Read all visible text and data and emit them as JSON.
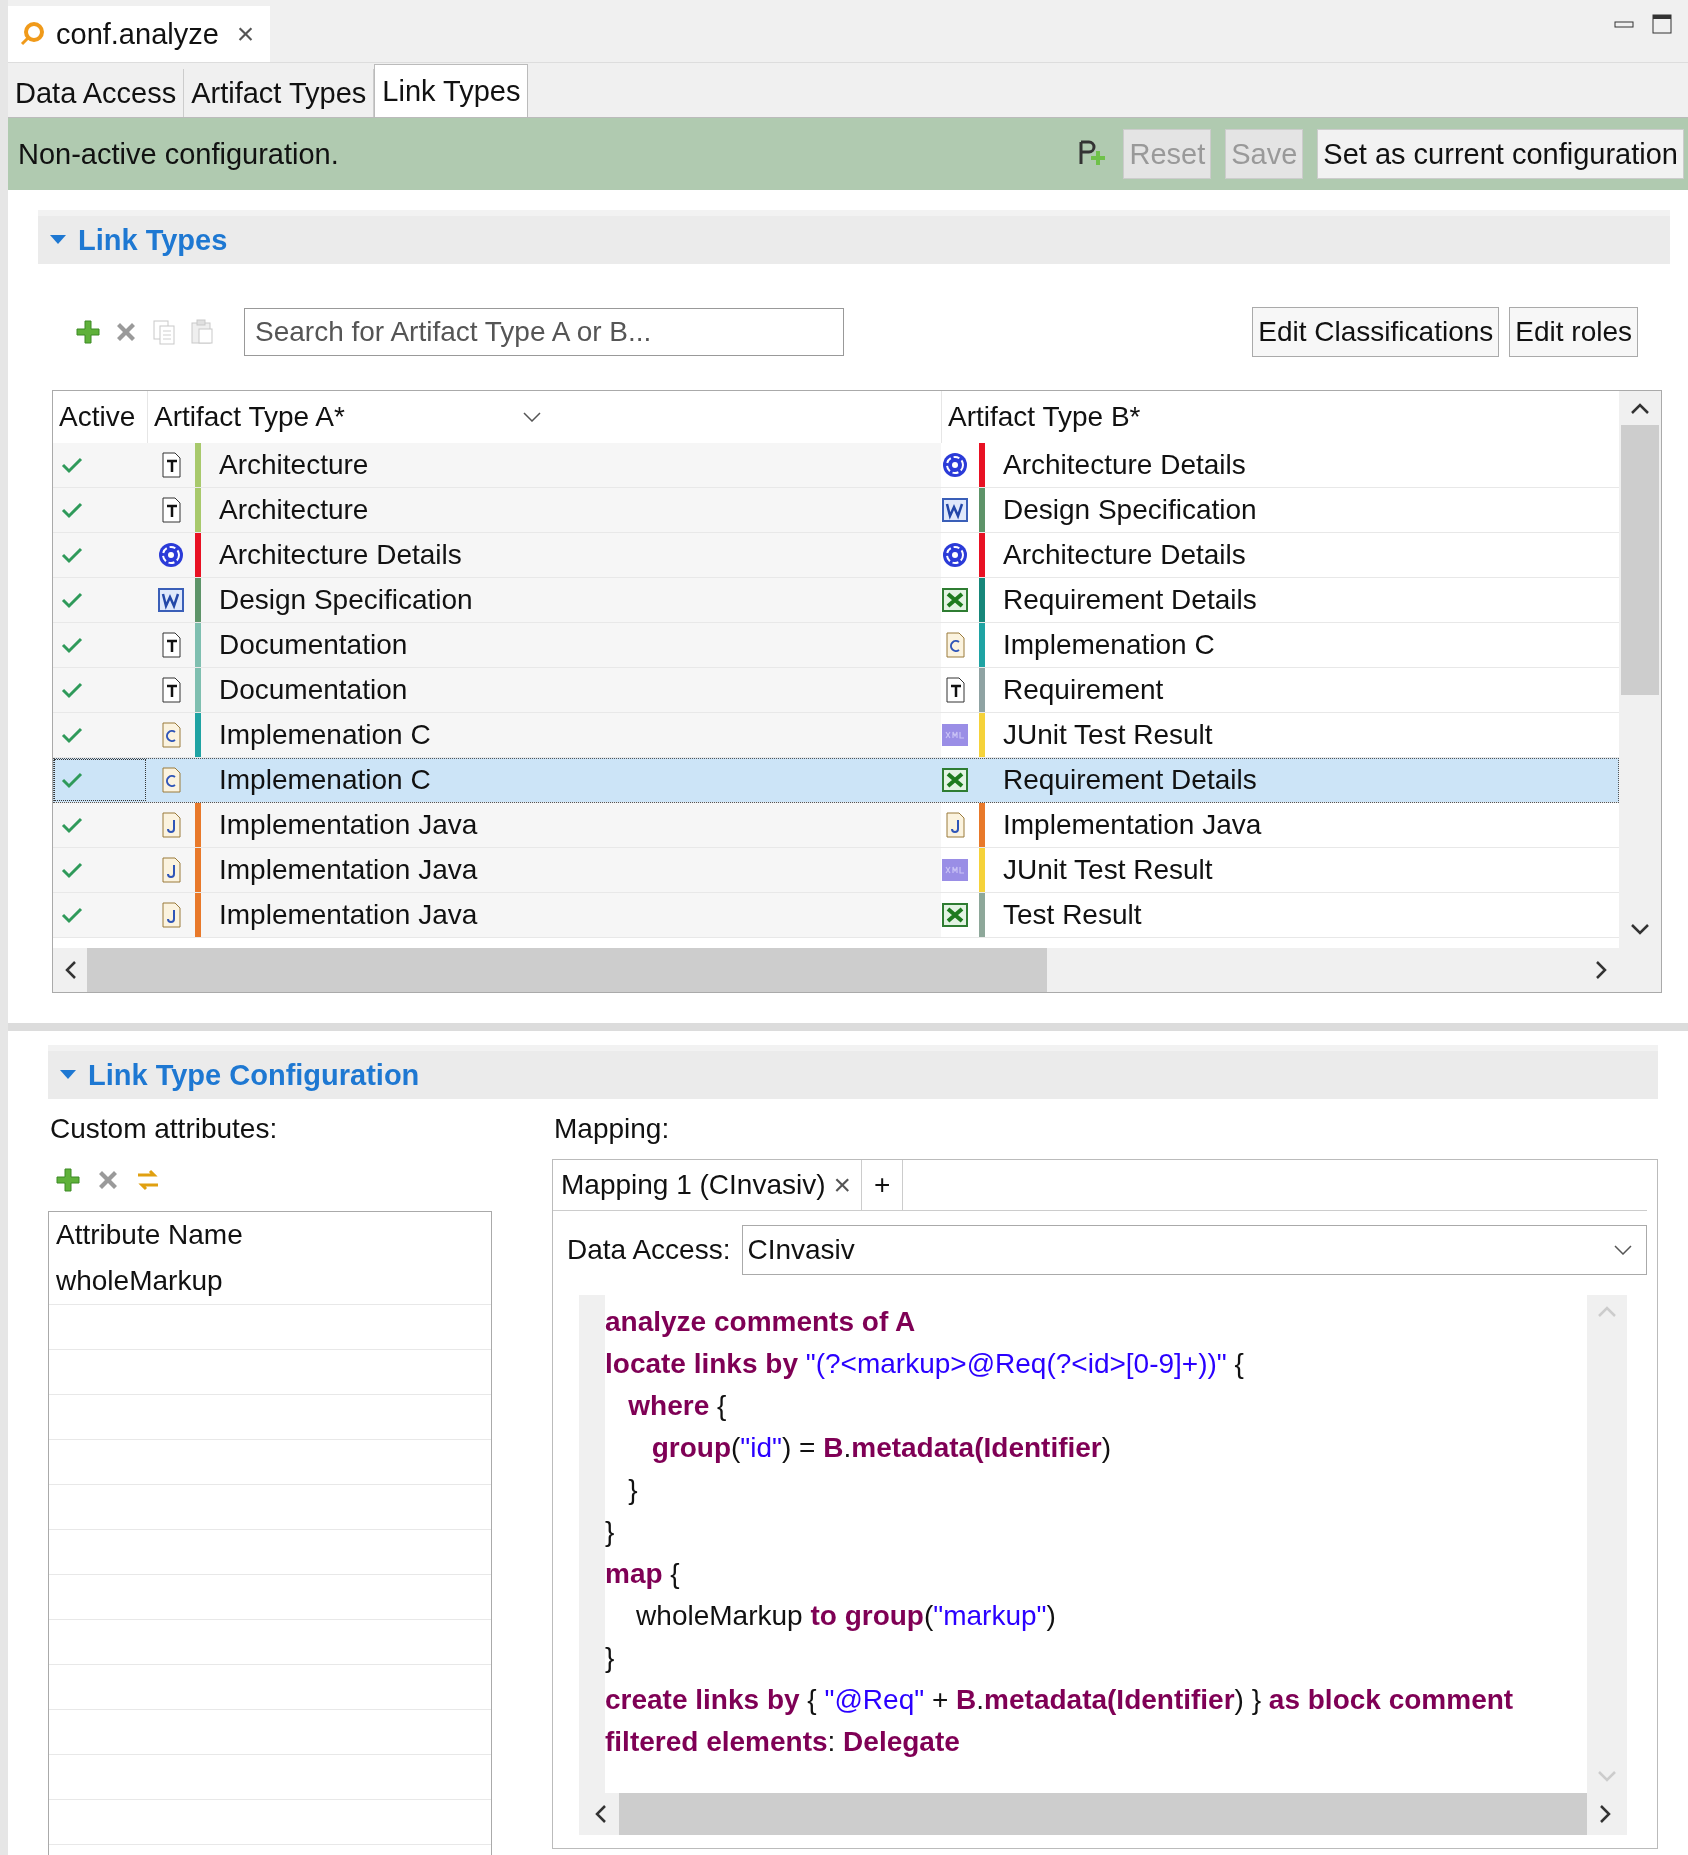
{
  "editor_tab": {
    "title": "conf.analyze",
    "close": "×"
  },
  "page_tabs": [
    {
      "label": "Data Access",
      "selected": false
    },
    {
      "label": "Artifact Types",
      "selected": false
    },
    {
      "label": "Link Types",
      "selected": true
    }
  ],
  "status_bar": {
    "message": "Non-active configuration.",
    "buttons": [
      {
        "label": "Reset",
        "disabled": true
      },
      {
        "label": "Save",
        "disabled": true
      },
      {
        "label": "Set as current configuration",
        "disabled": false
      }
    ]
  },
  "link_types": {
    "title": "Link Types",
    "toolbar": [
      {
        "kind": "add",
        "disabled": false
      },
      {
        "kind": "delete",
        "disabled": false
      },
      {
        "kind": "copy",
        "disabled": true
      },
      {
        "kind": "paste",
        "disabled": true
      }
    ],
    "search": {
      "placeholder": "Search for Artifact Type A or B..."
    },
    "buttons": [
      "Edit Classifications",
      "Edit roles"
    ],
    "table": {
      "columns": [
        "Active",
        "Artifact Type A*",
        "Artifact Type B*"
      ],
      "rows": [
        {
          "active": true,
          "selected": false,
          "a": {
            "name": "Architecture",
            "kind": "text",
            "color": "#a8c96c"
          },
          "b": {
            "name": "Architecture Details",
            "kind": "uml",
            "color": "#e81123"
          }
        },
        {
          "active": true,
          "selected": false,
          "a": {
            "name": "Architecture",
            "kind": "text",
            "color": "#a8c96c"
          },
          "b": {
            "name": "Design Specification",
            "kind": "word",
            "color": "#5e9469"
          }
        },
        {
          "active": true,
          "selected": false,
          "a": {
            "name": "Architecture Details",
            "kind": "uml",
            "color": "#e81123"
          },
          "b": {
            "name": "Architecture Details",
            "kind": "uml",
            "color": "#e81123"
          }
        },
        {
          "active": true,
          "selected": false,
          "a": {
            "name": "Design Specification",
            "kind": "word",
            "color": "#5e9469"
          },
          "b": {
            "name": "Requirement Details",
            "kind": "excel",
            "color": "#17877a"
          }
        },
        {
          "active": true,
          "selected": false,
          "a": {
            "name": "Documentation",
            "kind": "text",
            "color": "#7fbfb0"
          },
          "b": {
            "name": "Implemenation C",
            "kind": "c",
            "color": "#1fa3a3"
          }
        },
        {
          "active": true,
          "selected": false,
          "a": {
            "name": "Documentation",
            "kind": "text",
            "color": "#7fbfb0"
          },
          "b": {
            "name": "Requirement",
            "kind": "text",
            "color": "#8fa3a3"
          }
        },
        {
          "active": true,
          "selected": false,
          "a": {
            "name": "Implemenation C",
            "kind": "c",
            "color": "#1fa3a3"
          },
          "b": {
            "name": "JUnit Test Result",
            "kind": "xml",
            "color": "#f5d23a"
          }
        },
        {
          "active": true,
          "selected": true,
          "a": {
            "name": "Implemenation C",
            "kind": "c"
          },
          "b": {
            "name": "Requirement Details",
            "kind": "excel"
          }
        },
        {
          "active": true,
          "selected": false,
          "a": {
            "name": "Implementation Java",
            "kind": "java",
            "color": "#e8792a"
          },
          "b": {
            "name": "Implementation Java",
            "kind": "java",
            "color": "#e8792a"
          }
        },
        {
          "active": true,
          "selected": false,
          "a": {
            "name": "Implementation Java",
            "kind": "java",
            "color": "#e8792a"
          },
          "b": {
            "name": "JUnit Test Result",
            "kind": "xml",
            "color": "#f5d23a"
          }
        },
        {
          "active": true,
          "selected": false,
          "a": {
            "name": "Implementation Java",
            "kind": "java",
            "color": "#e8792a"
          },
          "b": {
            "name": "Test Result",
            "kind": "excel",
            "color": "#8ea89a"
          }
        }
      ]
    }
  },
  "link_type_configuration": {
    "title": "Link Type Configuration",
    "custom_attributes": {
      "label": "Custom attributes:",
      "toolbar": [
        {
          "kind": "add",
          "disabled": false
        },
        {
          "kind": "delete",
          "disabled": false
        },
        {
          "kind": "swap",
          "disabled": false
        }
      ],
      "column": "Attribute Name",
      "rows": [
        "wholeMarkup"
      ]
    },
    "mapping": {
      "label": "Mapping:",
      "tabs": [
        {
          "label": "Mapping 1 (CInvasiv)",
          "close": "×"
        }
      ],
      "add_tab": "+",
      "data_access": {
        "label": "Data Access:",
        "value": "CInvasiv"
      },
      "code": [
        [
          {
            "kind": "kw",
            "text": "analyze comments of A"
          }
        ],
        [
          {
            "kind": "kw",
            "text": "locate links by "
          },
          {
            "kind": "str",
            "text": "\"(?<markup>@Req(?<id>[0-9]+))\""
          },
          {
            "kind": "plain",
            "text": " {"
          }
        ],
        [
          {
            "kind": "kw",
            "text": "   where"
          },
          {
            "kind": "plain",
            "text": " {"
          }
        ],
        [
          {
            "kind": "kw",
            "text": "      group"
          },
          {
            "kind": "plain",
            "text": "("
          },
          {
            "kind": "str",
            "text": "\"id\""
          },
          {
            "kind": "plain",
            "text": ") = "
          },
          {
            "kind": "kw",
            "text": "B"
          },
          {
            "kind": "plain",
            "text": "."
          },
          {
            "kind": "kw",
            "text": "metadata(Identifier"
          },
          {
            "kind": "plain",
            "text": ")"
          }
        ],
        [
          {
            "kind": "plain",
            "text": "   }"
          }
        ],
        [
          {
            "kind": "plain",
            "text": "}"
          }
        ],
        [
          {
            "kind": "kw",
            "text": "map"
          },
          {
            "kind": "plain",
            "text": " {"
          }
        ],
        [
          {
            "kind": "plain",
            "text": "    wholeMarkup "
          },
          {
            "kind": "kw",
            "text": "to group"
          },
          {
            "kind": "plain",
            "text": "("
          },
          {
            "kind": "str",
            "text": "\"markup\""
          },
          {
            "kind": "plain",
            "text": ")"
          }
        ],
        [
          {
            "kind": "plain",
            "text": "}"
          }
        ],
        [
          {
            "kind": "kw",
            "text": "create links by"
          },
          {
            "kind": "plain",
            "text": " { "
          },
          {
            "kind": "str",
            "text": "\"@Req\""
          },
          {
            "kind": "plain",
            "text": " + "
          },
          {
            "kind": "kw",
            "text": "B"
          },
          {
            "kind": "plain",
            "text": "."
          },
          {
            "kind": "kw",
            "text": "metadata(Identifier"
          },
          {
            "kind": "plain",
            "text": ") } "
          },
          {
            "kind": "kw",
            "text": "as block comment"
          }
        ],
        [
          {
            "kind": "kw",
            "text": "filtered elements"
          },
          {
            "kind": "plain",
            "text": ": "
          },
          {
            "kind": "kw",
            "text": "Delegate"
          }
        ]
      ]
    }
  }
}
